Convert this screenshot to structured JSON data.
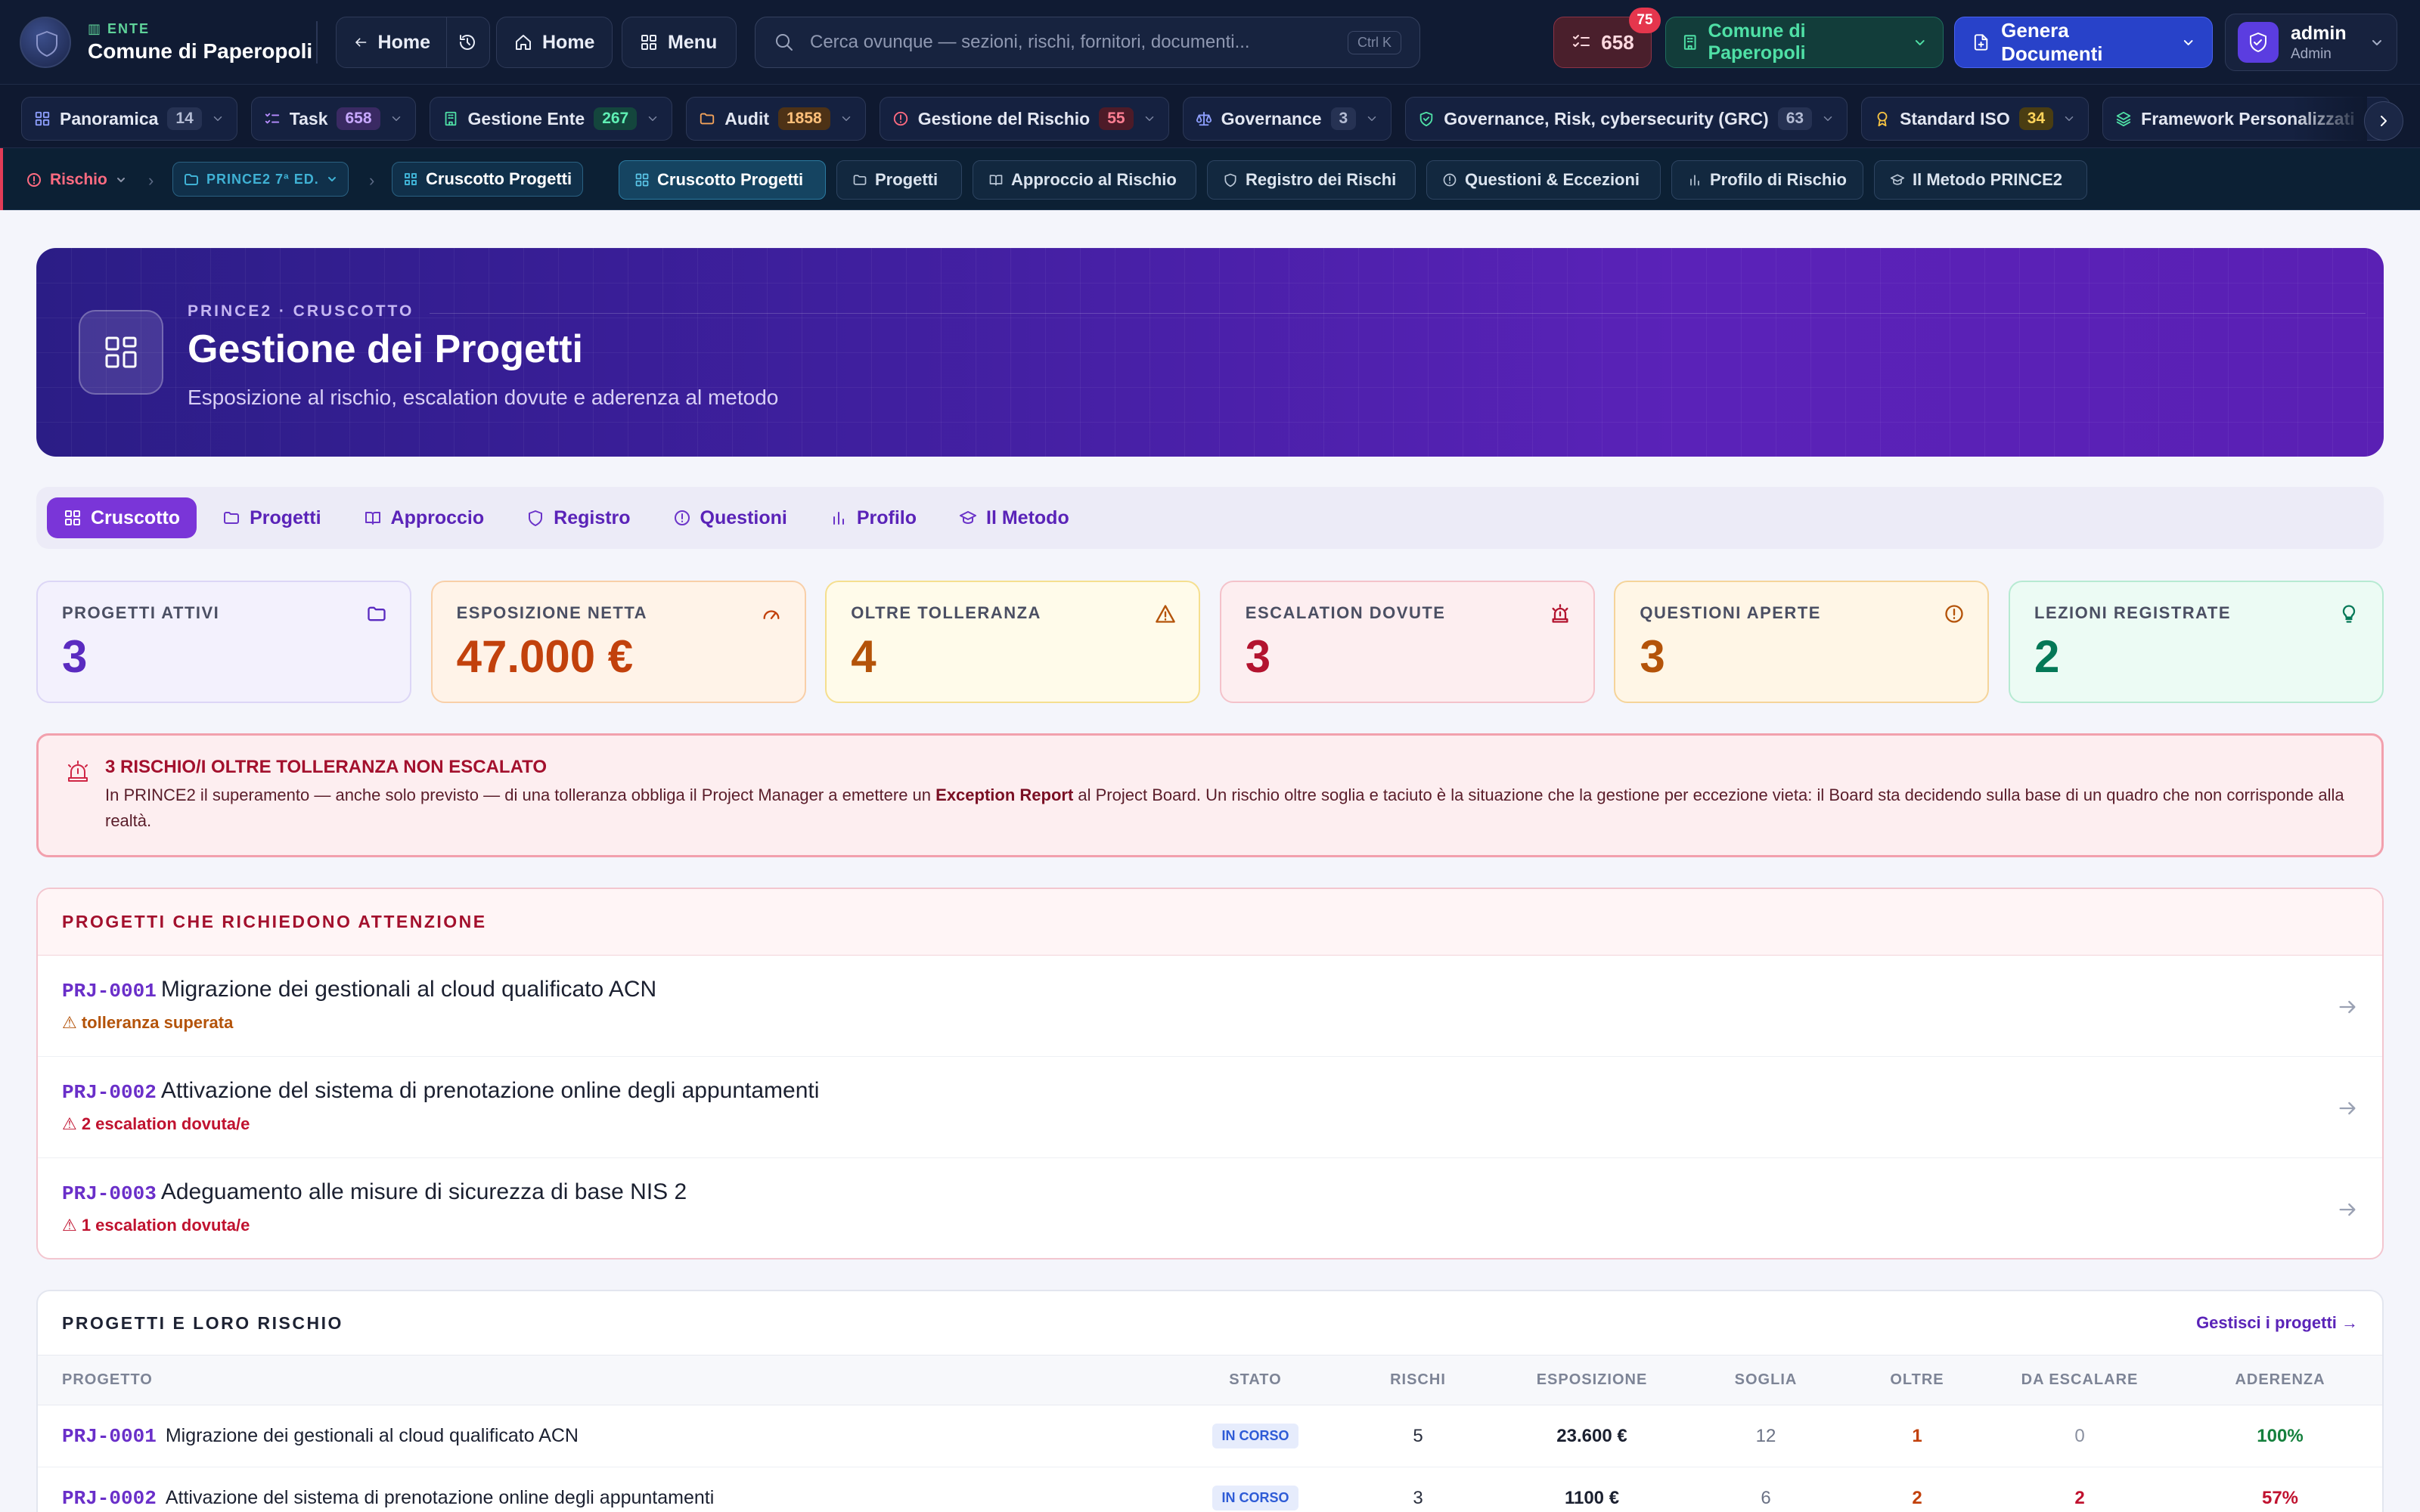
{
  "header": {
    "org_kicker": "ENTE",
    "org_name": "Comune di Paperopoli",
    "back_home": "Home",
    "home": "Home",
    "menu": "Menu",
    "search_placeholder": "Cerca ovunque — sezioni, rischi, fornitori, documenti...",
    "search_shortcut": "Ctrl K",
    "task_count": "658",
    "notification_count": "75",
    "entity_selector": "Comune di Paperopoli",
    "generate_docs": "Genera Documenti",
    "user_name": "admin",
    "user_role": "Admin"
  },
  "modules": [
    {
      "label": "Panoramica",
      "count": "14",
      "icon": "grid-icon",
      "color": "#8fa0ff"
    },
    {
      "label": "Task",
      "count": "658",
      "icon": "checklist-icon",
      "color": "#b68cff"
    },
    {
      "label": "Gestione Ente",
      "count": "267",
      "icon": "building-icon",
      "color": "#4fe0a6"
    },
    {
      "label": "Audit",
      "count": "1858",
      "icon": "folder-icon",
      "color": "#f4a35a"
    },
    {
      "label": "Gestione del Rischio",
      "count": "55",
      "icon": "alert-circle-icon",
      "color": "#ff6b81"
    },
    {
      "label": "Governance",
      "count": "3",
      "icon": "scale-icon",
      "color": "#8fa0ff"
    },
    {
      "label": "Governance, Risk, cybersecurity (GRC)",
      "count": "63",
      "icon": "shield-check-icon",
      "color": "#4fe0a6"
    },
    {
      "label": "Standard ISO",
      "count": "34",
      "icon": "award-icon",
      "color": "#f6c342"
    },
    {
      "label": "Framework Personalizzati",
      "count": "",
      "icon": "layers-icon",
      "color": "#4fe0a6"
    }
  ],
  "breadcrumb": {
    "root": "Rischio",
    "section": "PRINCE2 7ª ED.",
    "current": "Cruscotto Progetti"
  },
  "subnav": [
    {
      "label": "Cruscotto Progetti",
      "icon": "grid-icon"
    },
    {
      "label": "Progetti",
      "icon": "folder-icon"
    },
    {
      "label": "Approccio al Rischio",
      "icon": "book-icon"
    },
    {
      "label": "Registro dei Rischi",
      "icon": "shield-icon"
    },
    {
      "label": "Questioni & Eccezioni",
      "icon": "alert-circle-icon"
    },
    {
      "label": "Profilo di Rischio",
      "icon": "bar-chart-icon"
    },
    {
      "label": "Il Metodo PRINCE2",
      "icon": "graduation-cap-icon"
    }
  ],
  "hero": {
    "kicker": "PRINCE2 · CRUSCOTTO",
    "title": "Gestione dei Progetti",
    "subtitle": "Esposizione al rischio, escalation dovute e aderenza al metodo"
  },
  "tabs": [
    {
      "label": "Cruscotto",
      "icon": "grid-icon"
    },
    {
      "label": "Progetti",
      "icon": "folder-icon"
    },
    {
      "label": "Approccio",
      "icon": "book-icon"
    },
    {
      "label": "Registro",
      "icon": "shield-icon"
    },
    {
      "label": "Questioni",
      "icon": "alert-circle-icon"
    },
    {
      "label": "Profilo",
      "icon": "bar-chart-icon"
    },
    {
      "label": "Il Metodo",
      "icon": "graduation-cap-icon"
    }
  ],
  "kpis": [
    {
      "label": "PROGETTI ATTIVI",
      "value": "3",
      "icon": "folder-icon",
      "bg": "#f3f1fd",
      "border": "#dcd6f6",
      "color": "#5a2bc0",
      "label_color": "#4b4f63"
    },
    {
      "label": "ESPOSIZIONE NETTA",
      "value": "47.000 €",
      "icon": "gauge-icon",
      "bg": "#fff3e8",
      "border": "#f8cfa8",
      "color": "#c2410c",
      "label_color": "#4b4f63"
    },
    {
      "label": "OLTRE TOLLERANZA",
      "value": "4",
      "icon": "warning-triangle-icon",
      "bg": "#fffbea",
      "border": "#f5df8f",
      "color": "#b45309",
      "label_color": "#4b4f63"
    },
    {
      "label": "ESCALATION DOVUTE",
      "value": "3",
      "icon": "siren-icon",
      "bg": "#fdeef0",
      "border": "#f4c2ca",
      "color": "#b3132f",
      "label_color": "#4b4f63"
    },
    {
      "label": "QUESTIONI APERTE",
      "value": "3",
      "icon": "alert-circle-icon",
      "bg": "#fff6e6",
      "border": "#f5d49a",
      "color": "#b45309",
      "label_color": "#4b4f63"
    },
    {
      "label": "LEZIONI REGISTRATE",
      "value": "2",
      "icon": "lightbulb-icon",
      "bg": "#ecfbf4",
      "border": "#b6ead2",
      "color": "#047857",
      "label_color": "#4b4f63"
    }
  ],
  "alert": {
    "title": "3 RISCHIO/I OLTRE TOLLERANZA NON ESCALATO",
    "body_before": "In PRINCE2 il superamento — anche solo previsto — di una tolleranza obbliga il Project Manager a emettere un ",
    "body_bold": "Exception Report",
    "body_after": " al Project Board. Un rischio oltre soglia e taciuto è la situazione che la gestione per eccezione vieta: il Board sta decidendo sulla base di un quadro che non corrisponde alla realtà."
  },
  "attention": {
    "title": "PROGETTI CHE RICHIEDONO ATTENZIONE",
    "items": [
      {
        "code": "PRJ-0001",
        "name": "Migrazione dei gestionali al cloud qualificato ACN",
        "flag": "⚠ tolleranza superata",
        "flag_color": "#b45309"
      },
      {
        "code": "PRJ-0002",
        "name": "Attivazione del sistema di prenotazione online degli appuntamenti",
        "flag": "⚠ 2 escalation dovuta/e",
        "flag_color": "#c0122f"
      },
      {
        "code": "PRJ-0003",
        "name": "Adeguamento alle misure di sicurezza di base NIS 2",
        "flag": "⚠ 1 escalation dovuta/e",
        "flag_color": "#c0122f"
      }
    ]
  },
  "projects_table": {
    "title": "PROGETTI E LORO RISCHIO",
    "manage_link": "Gestisci i progetti →",
    "columns": [
      "PROGETTO",
      "STATO",
      "RISCHI",
      "ESPOSIZIONE",
      "SOGLIA",
      "OLTRE",
      "DA ESCALARE",
      "ADERENZA"
    ],
    "rows": [
      {
        "code": "PRJ-0001",
        "name": "Migrazione dei gestionali al cloud qualificato ACN",
        "status": "IN CORSO",
        "risks": "5",
        "exposure": "23.600 €",
        "threshold": "12",
        "over": "1",
        "over_color": "#c2410c",
        "escalate": "0",
        "escalate_color": "#8a90a0",
        "adherence": "100%",
        "adherence_color": "#15803d"
      },
      {
        "code": "PRJ-0002",
        "name": "Attivazione del sistema di prenotazione online degli appuntamenti",
        "status": "IN CORSO",
        "risks": "3",
        "exposure": "1100 €",
        "threshold": "6",
        "over": "2",
        "over_color": "#c2410c",
        "escalate": "2",
        "escalate_color": "#c0122f",
        "adherence": "57%",
        "adherence_color": "#c0122f"
      }
    ]
  }
}
